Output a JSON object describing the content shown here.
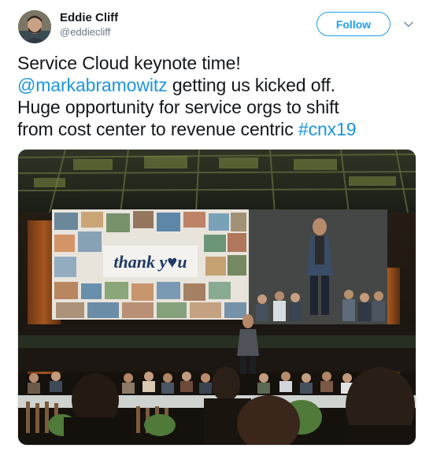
{
  "author": {
    "display_name": "Eddie Cliff",
    "handle": "@eddiecliff"
  },
  "actions": {
    "follow_label": "Follow"
  },
  "tweet": {
    "line1": "Service Cloud keynote time!",
    "mention": "@markabramowitz",
    "line2_rest": " getting us kicked off.",
    "line3": "Huge opportunity for service orgs to shift",
    "line4_text": "from cost center to revenue centric ",
    "hashtag": "#cnx19"
  },
  "media": {
    "screen_text": "thank y♥u"
  },
  "colors": {
    "accent": "#1da1f2",
    "link": "#1b95e0",
    "muted": "#657786"
  },
  "icons": {
    "caret": "chevron-down-icon"
  }
}
